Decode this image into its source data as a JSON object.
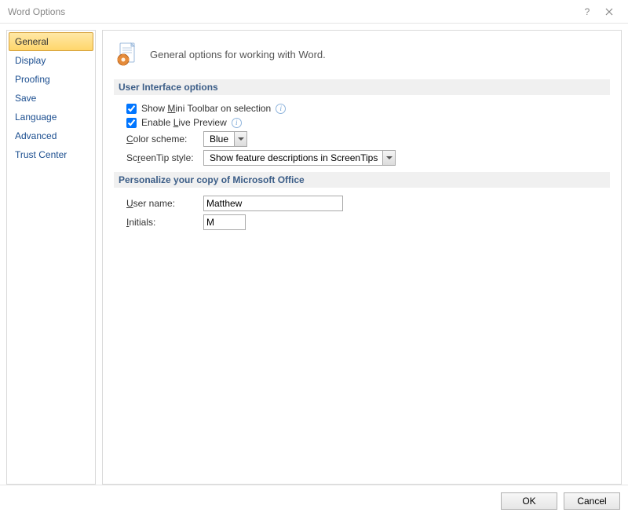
{
  "window": {
    "title": "Word Options"
  },
  "sidebar": {
    "items": [
      {
        "label": "General",
        "selected": true
      },
      {
        "label": "Display"
      },
      {
        "label": "Proofing"
      },
      {
        "label": "Save"
      },
      {
        "label": "Language"
      },
      {
        "label": "Advanced"
      },
      {
        "label": "Trust Center"
      }
    ]
  },
  "header": {
    "text": "General options for working with Word."
  },
  "sections": {
    "ui": {
      "title": "User Interface options",
      "mini_toolbar": {
        "label_pre": "Show ",
        "label_u": "M",
        "label_post": "ini Toolbar on selection",
        "checked": true
      },
      "live_preview": {
        "label_pre": "Enable ",
        "label_u": "L",
        "label_post": "ive Preview",
        "checked": true
      },
      "color_scheme": {
        "label_u": "C",
        "label_post": "olor scheme:",
        "value": "Blue"
      },
      "screentip": {
        "label_pre": "Sc",
        "label_u": "r",
        "label_post": "eenTip style:",
        "value": "Show feature descriptions in ScreenTips"
      }
    },
    "personalize": {
      "title": "Personalize your copy of Microsoft Office",
      "user_name": {
        "label_u": "U",
        "label_post": "ser name:",
        "value": "Matthew"
      },
      "initials": {
        "label_u": "I",
        "label_post": "nitials:",
        "value": "M"
      }
    }
  },
  "footer": {
    "ok": "OK",
    "cancel": "Cancel"
  }
}
